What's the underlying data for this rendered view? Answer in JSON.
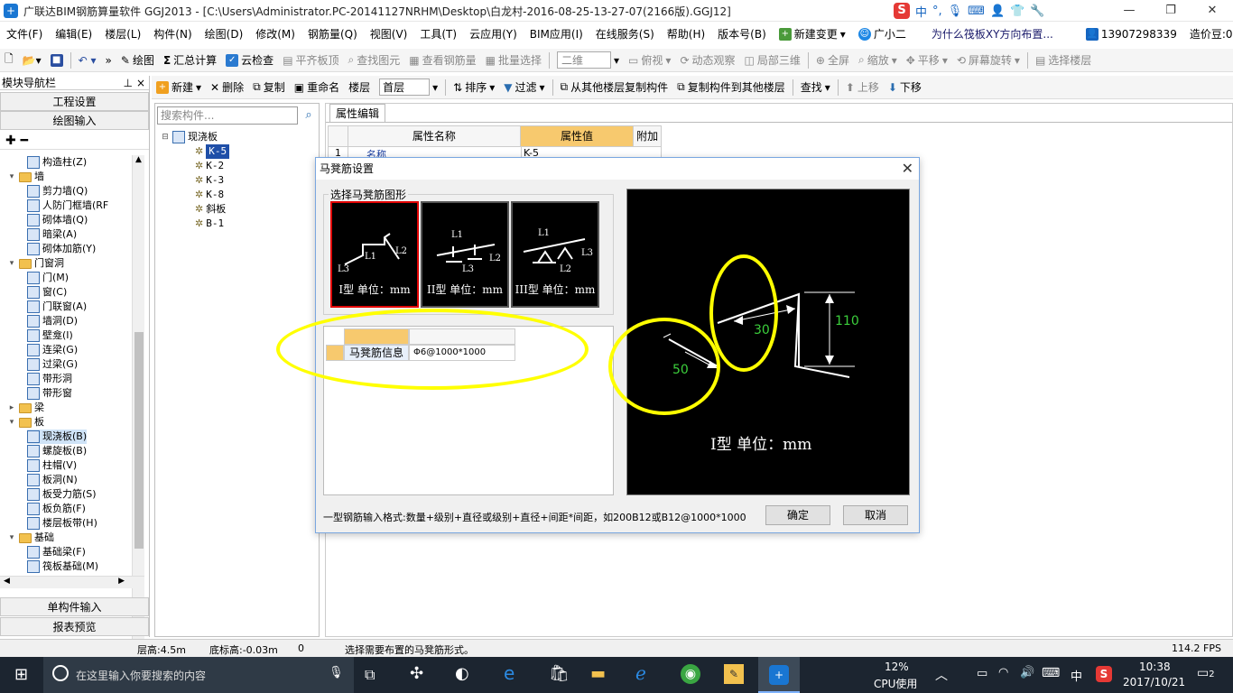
{
  "title": "广联达BIM钢筋算量软件 GGJ2013 - [C:\\Users\\Administrator.PC-20141127NRHM\\Desktop\\白龙村-2016-08-25-13-27-07(2166版).GGJ12]",
  "ime": {
    "lang": "中",
    "punct": "°,"
  },
  "menu": [
    "文件(F)",
    "编辑(E)",
    "楼层(L)",
    "构件(N)",
    "绘图(D)",
    "修改(M)",
    "钢筋量(Q)",
    "视图(V)",
    "工具(T)",
    "云应用(Y)",
    "BIM应用(I)",
    "在线服务(S)",
    "帮助(H)",
    "版本号(B)"
  ],
  "menu_right": {
    "change": "新建变更",
    "assistant": "广小二",
    "question": "为什么筏板XY方向布置...",
    "phone": "13907298339",
    "beans": "造价豆:0"
  },
  "toolbar1": [
    "绘图",
    "汇总计算",
    "云检查",
    "平齐板顶",
    "查找图元",
    "查看钢筋量",
    "批量选择",
    "二维",
    "俯视",
    "动态观察",
    "局部三维",
    "全屏",
    "缩放",
    "平移",
    "屏幕旋转",
    "选择楼层"
  ],
  "toolbar2": {
    "new": "新建",
    "delete": "删除",
    "copy": "复制",
    "rename": "重命名",
    "floor_label": "楼层",
    "floor_value": "首层",
    "sort": "排序",
    "filter": "过滤",
    "copy_from": "从其他楼层复制构件",
    "copy_to": "复制构件到其他楼层",
    "find": "查找",
    "up": "上移",
    "down": "下移"
  },
  "nav": {
    "title": "模块导航栏",
    "project_settings": "工程设置",
    "draw_input": "绘图输入",
    "single_input": "单构件输入",
    "report": "报表预览",
    "tree": [
      {
        "label": "构造柱(Z)",
        "level": 2,
        "type": "item"
      },
      {
        "label": "墙",
        "level": 1,
        "type": "folder"
      },
      {
        "label": "剪力墙(Q)",
        "level": 2,
        "type": "item"
      },
      {
        "label": "人防门框墙(RF",
        "level": 2,
        "type": "item"
      },
      {
        "label": "砌体墙(Q)",
        "level": 2,
        "type": "item"
      },
      {
        "label": "暗梁(A)",
        "level": 2,
        "type": "item"
      },
      {
        "label": "砌体加筋(Y)",
        "level": 2,
        "type": "item"
      },
      {
        "label": "门窗洞",
        "level": 1,
        "type": "folder"
      },
      {
        "label": "门(M)",
        "level": 2,
        "type": "item"
      },
      {
        "label": "窗(C)",
        "level": 2,
        "type": "item"
      },
      {
        "label": "门联窗(A)",
        "level": 2,
        "type": "item"
      },
      {
        "label": "墙洞(D)",
        "level": 2,
        "type": "item"
      },
      {
        "label": "壁龛(I)",
        "level": 2,
        "type": "item"
      },
      {
        "label": "连梁(G)",
        "level": 2,
        "type": "item"
      },
      {
        "label": "过梁(G)",
        "level": 2,
        "type": "item"
      },
      {
        "label": "带形洞",
        "level": 2,
        "type": "item"
      },
      {
        "label": "带形窗",
        "level": 2,
        "type": "item"
      },
      {
        "label": "梁",
        "level": 1,
        "type": "folder"
      },
      {
        "label": "板",
        "level": 1,
        "type": "folder"
      },
      {
        "label": "现浇板(B)",
        "level": 2,
        "type": "item"
      },
      {
        "label": "螺旋板(B)",
        "level": 2,
        "type": "item"
      },
      {
        "label": "柱帽(V)",
        "level": 2,
        "type": "item"
      },
      {
        "label": "板洞(N)",
        "level": 2,
        "type": "item"
      },
      {
        "label": "板受力筋(S)",
        "level": 2,
        "type": "item"
      },
      {
        "label": "板负筋(F)",
        "level": 2,
        "type": "item"
      },
      {
        "label": "楼层板带(H)",
        "level": 2,
        "type": "item"
      },
      {
        "label": "基础",
        "level": 1,
        "type": "folder"
      },
      {
        "label": "基础梁(F)",
        "level": 2,
        "type": "item"
      },
      {
        "label": "筏板基础(M)",
        "level": 2,
        "type": "item"
      }
    ]
  },
  "components": {
    "search_placeholder": "搜索构件...",
    "root": "现浇板",
    "items": [
      "K-5",
      "K-2",
      "K-3",
      "K-8",
      "斜板",
      "B-1"
    ]
  },
  "property": {
    "tab": "属性编辑",
    "col_name": "属性名称",
    "col_value": "属性值",
    "col_extra": "附加",
    "row1_index": "1",
    "row1_name": "名称",
    "row1_value": "K-5"
  },
  "dialog": {
    "title": "马凳筋设置",
    "group": "选择马凳筋图形",
    "shapes": [
      "I型 单位：mm",
      "II型 单位：mm",
      "III型 单位：mm"
    ],
    "shape_labels": {
      "L1": "L1",
      "L2": "L2",
      "L3": "L3"
    },
    "info_label": "马凳筋信息",
    "info_value": "Φ6@1000*1000",
    "preview": {
      "dim1": "50",
      "dim2": "30",
      "dim3": "110",
      "caption": "I型 单位：mm"
    },
    "hint": "一型钢筋输入格式:数量+级别+直径或级别+直径+间距*间距，如200B12或B12@1000*1000",
    "ok": "确定",
    "cancel": "取消"
  },
  "status": {
    "floor_height": "层高:4.5m",
    "base_height": "底标高:-0.03m",
    "num": "0",
    "message": "选择需要布置的马凳筋形式。",
    "fps": "114.2 FPS"
  },
  "taskbar": {
    "search": "在这里输入你要搜索的内容",
    "cpu_pct": "12%",
    "cpu_label": "CPU使用",
    "lang": "中",
    "time": "10:38",
    "date": "2017/10/21",
    "notif": "2"
  }
}
